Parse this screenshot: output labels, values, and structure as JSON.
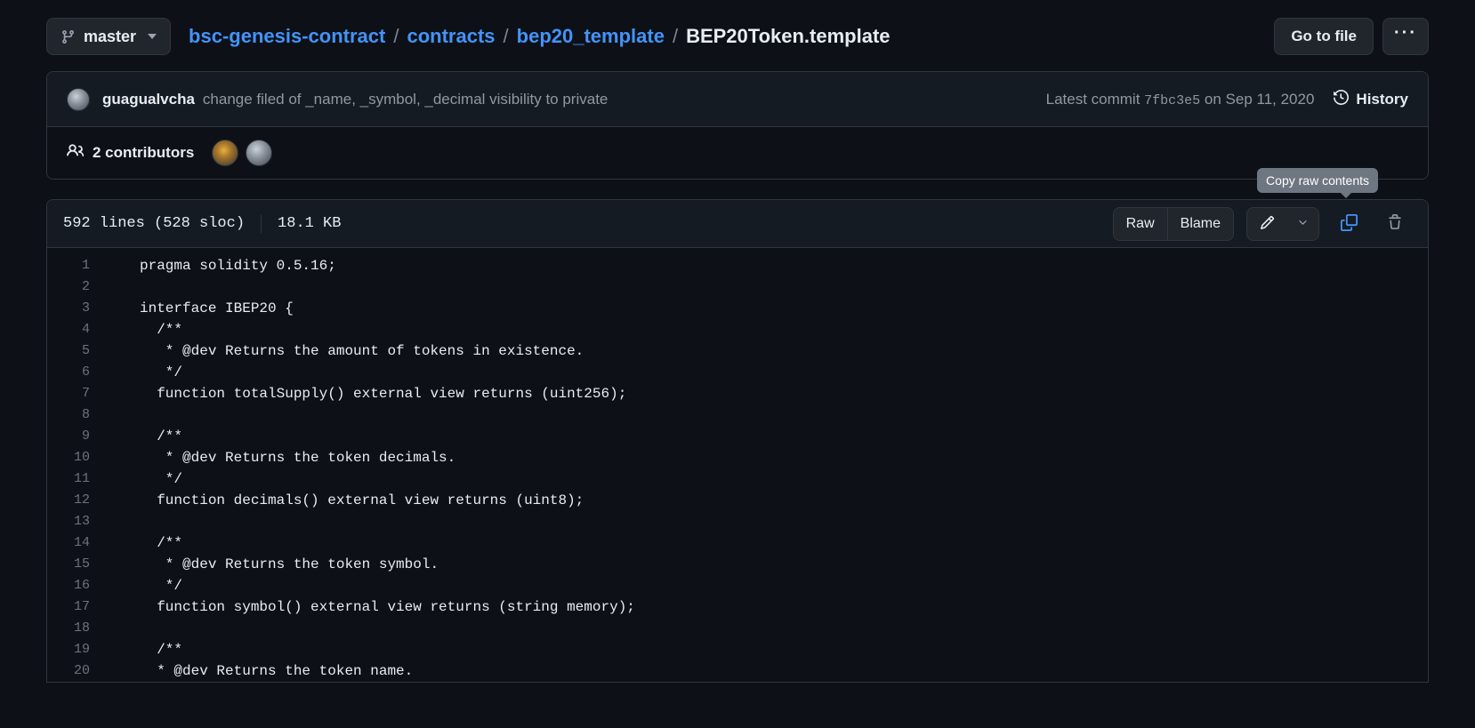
{
  "topbar": {
    "branch": {
      "label": "master",
      "icon": "branch-icon"
    },
    "breadcrumb": {
      "parts": [
        "bsc-genesis-contract",
        "contracts",
        "bep20_template"
      ],
      "separator": "/",
      "current": "BEP20Token.template"
    },
    "go_to_file_label": "Go to file",
    "more_label": "···"
  },
  "commit": {
    "author": "guagualvcha",
    "message": "change filed of _name, _symbol, _decimal visibility to private",
    "latest_prefix": "Latest commit",
    "sha": "7fbc3e5",
    "date": "on Sep 11, 2020",
    "history_label": "History"
  },
  "contributors": {
    "count": "2",
    "label": "2 contributors"
  },
  "file": {
    "lines": "592 lines (528 sloc)",
    "size": "18.1 KB",
    "raw_label": "Raw",
    "blame_label": "Blame",
    "edit_icon": "pencil-icon",
    "caret_icon": "chevron-down-icon",
    "copy_icon": "copy-icon",
    "delete_icon": "trash-icon",
    "tooltip": "Copy raw contents"
  },
  "colors": {
    "background": "#0d1117",
    "panel": "#151b23",
    "border": "#30363d",
    "link": "#4493f8",
    "text": "#e6edf3",
    "muted": "#9198a1",
    "accent": "#4493f8",
    "tooltip_bg": "#6e7681"
  },
  "code": {
    "line_numbers": [
      "1",
      "2",
      "3",
      "4",
      "5",
      "6",
      "7",
      "8",
      "9",
      "10",
      "11",
      "12",
      "13",
      "14",
      "15",
      "16",
      "17",
      "18",
      "19",
      "20"
    ],
    "lines": [
      "pragma solidity 0.5.16;",
      "",
      "interface IBEP20 {",
      "  /**",
      "   * @dev Returns the amount of tokens in existence.",
      "   */",
      "  function totalSupply() external view returns (uint256);",
      "",
      "  /**",
      "   * @dev Returns the token decimals.",
      "   */",
      "  function decimals() external view returns (uint8);",
      "",
      "  /**",
      "   * @dev Returns the token symbol.",
      "   */",
      "  function symbol() external view returns (string memory);",
      "",
      "  /**",
      "  * @dev Returns the token name."
    ]
  }
}
